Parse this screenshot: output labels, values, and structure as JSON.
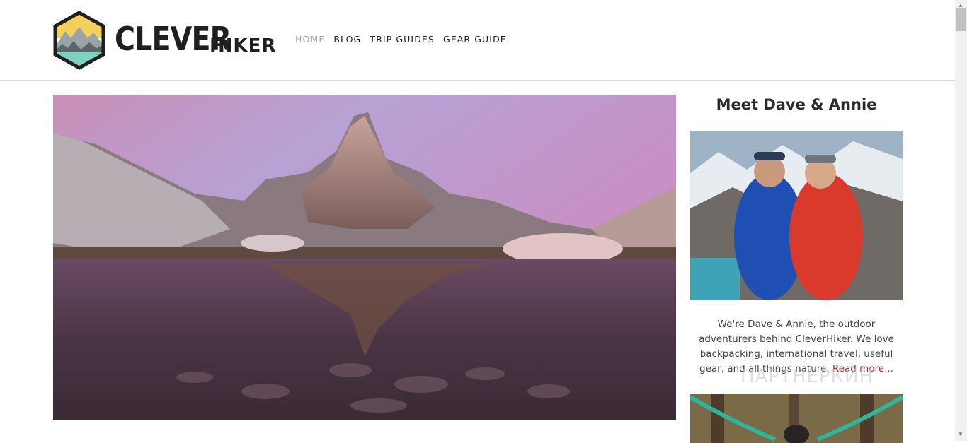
{
  "brand": {
    "name_part1": "CLEVER",
    "name_part2": "HIKER"
  },
  "nav": [
    {
      "label": "HOME",
      "active": true
    },
    {
      "label": "BLOG",
      "active": false
    },
    {
      "label": "TRIP GUIDES",
      "active": false
    },
    {
      "label": "GEAR GUIDE",
      "active": false
    }
  ],
  "sidebar": {
    "title": "Meet Dave & Annie",
    "about_text": "We're Dave & Annie, the outdoor adventurers behind CleverHiker. We love backpacking, international travel, useful gear, and all things nature.",
    "read_more": "Read more..."
  },
  "watermark": "ПАРТНЕРКИН",
  "colors": {
    "link_accent": "#b52a2a",
    "nav_active": "#a8a8a8",
    "badge_yellow": "#f5cf5b",
    "badge_teal": "#7fd1c3"
  }
}
